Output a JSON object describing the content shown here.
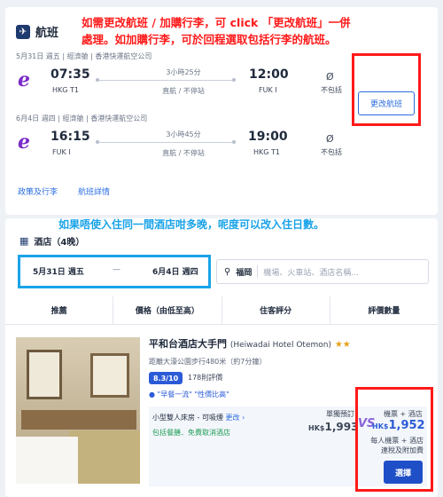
{
  "annotations": {
    "top_line1": "如需更改航班 / 加購行李，可 click 「更改航班」一併",
    "top_line2": "處理。如加購行李，可於回程選取包括行李的航班。",
    "middle": "如果唔使入住同一間酒店咁多晚，呢度可以改入住日數。"
  },
  "flights": {
    "section_title": "航班",
    "outbound": {
      "meta": "5月31日 週五 | 經濟艙 | 香港快運航空公司",
      "depart_time": "07:35",
      "depart_code": "HKG T1",
      "duration": "3小時25分",
      "stops": "直航 / 不停站",
      "arrive_time": "12:00",
      "arrive_code": "FUK I",
      "baggage_icon": "Ø",
      "baggage": "不包括"
    },
    "return": {
      "meta": "6月4日 週四 | 經濟艙 | 香港快運航空公司",
      "depart_time": "16:15",
      "depart_code": "FUK I",
      "duration": "3小時45分",
      "stops": "直航 / 不停站",
      "arrive_time": "19:00",
      "arrive_code": "HKG T1",
      "baggage_icon": "Ø",
      "baggage": "不包括"
    },
    "change_button": "更改航班",
    "links": [
      "政策及行李",
      "航班詳情"
    ],
    "airline_logo": "e"
  },
  "hotel": {
    "section_title": "酒店（4晚）",
    "checkin": "5月31日 週五",
    "dash": "—",
    "checkout": "6月4日 週四",
    "location": "福岡",
    "location_placeholder": "機場、火車站、酒店名稱...",
    "tabs": [
      "推薦",
      "價格（由低至高）",
      "住客評分",
      "評價數量"
    ],
    "name": "平和台酒店大手門",
    "name_en": "(Heiwadai Hotel Otemon)",
    "stars": "★★",
    "distance": "距離大濠公園步行480米（約7分鐘）",
    "score": "8.3/10",
    "reviews": "178則評價",
    "quote": "\"早餐一流\" \"性價比高\"",
    "room_name": "小型雙人床房 - 可吸煙",
    "room_change": "更改 ›",
    "room_sub": "包括餐膳．免費取消酒店",
    "single_label": "單獨預訂",
    "single_currency": "HK$",
    "single_price": "1,993",
    "vs": "VS",
    "pkg_label": "機票 + 酒店",
    "pkg_currency": "HK$",
    "pkg_price": "1,952",
    "pkg_note1": "每人機票 + 酒店",
    "pkg_note2": "連稅及附加費",
    "select_button": "選擇"
  }
}
